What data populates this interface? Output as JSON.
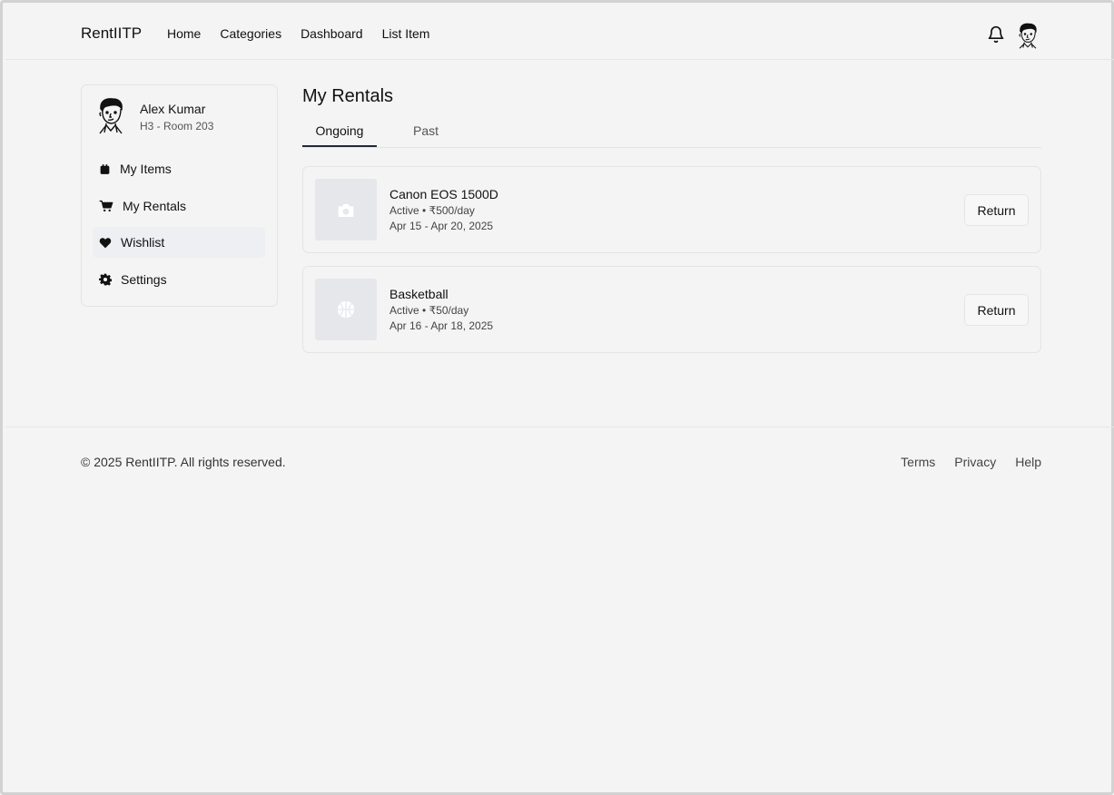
{
  "header": {
    "brand": "RentIITP",
    "nav": [
      "Home",
      "Categories",
      "Dashboard",
      "List Item"
    ]
  },
  "sidebar": {
    "profile": {
      "name": "Alex Kumar",
      "room": "H3 - Room 203"
    },
    "items": [
      {
        "label": "My Items",
        "icon": "calendar-icon"
      },
      {
        "label": "My Rentals",
        "icon": "cart-icon"
      },
      {
        "label": "Wishlist",
        "icon": "heart-icon"
      },
      {
        "label": "Settings",
        "icon": "gear-icon"
      }
    ]
  },
  "main": {
    "title": "My Rentals",
    "tabs": [
      {
        "label": "Ongoing",
        "active": true
      },
      {
        "label": "Past",
        "active": false
      }
    ],
    "rentals": [
      {
        "name": "Canon EOS 1500D",
        "status": "Active",
        "price": "₹500/day",
        "dates": "Apr 15 - Apr 20, 2025",
        "icon": "camera-icon",
        "action": "Return"
      },
      {
        "name": "Basketball",
        "status": "Active",
        "price": "₹50/day",
        "dates": "Apr 16 - Apr 18, 2025",
        "icon": "basketball-icon",
        "action": "Return"
      }
    ]
  },
  "footer": {
    "copyright": "© 2025 RentIITP. All rights reserved.",
    "links": [
      "Terms",
      "Privacy",
      "Help"
    ]
  },
  "colors": {
    "background": "#f4f4f4",
    "thumb": "#e5e7eb",
    "border": "#e4e4e4",
    "tab_underline": "#1f2937"
  }
}
